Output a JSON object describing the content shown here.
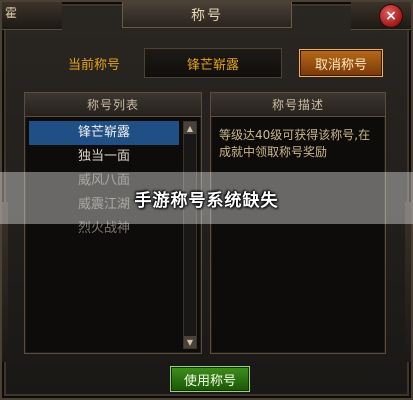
{
  "corner_text": "霍",
  "window": {
    "title": "称号",
    "close_icon": "×"
  },
  "current": {
    "label": "当前称号",
    "value": "锋芒崭露",
    "cancel_label": "取消称号"
  },
  "list_panel": {
    "header": "称号列表",
    "items": [
      {
        "label": "锋芒崭露",
        "state": "selected"
      },
      {
        "label": "独当一面",
        "state": "normal"
      },
      {
        "label": "威风八面",
        "state": "dim"
      },
      {
        "label": "威震江湖",
        "state": "dim"
      },
      {
        "label": "烈火战神",
        "state": "dim"
      }
    ],
    "scroll_up": "▲",
    "scroll_down": "▼"
  },
  "desc_panel": {
    "header": "称号描述",
    "text": "等级达40级可获得该称号,在成就中领取称号奖励"
  },
  "banner_text": "手游称号系统缺失",
  "use_button_label": "使用称号",
  "colors": {
    "accent_gold": "#e6a21c",
    "selected_bg": "#1f4f84",
    "close_red": "#a11818",
    "use_green": "#1b5606"
  }
}
